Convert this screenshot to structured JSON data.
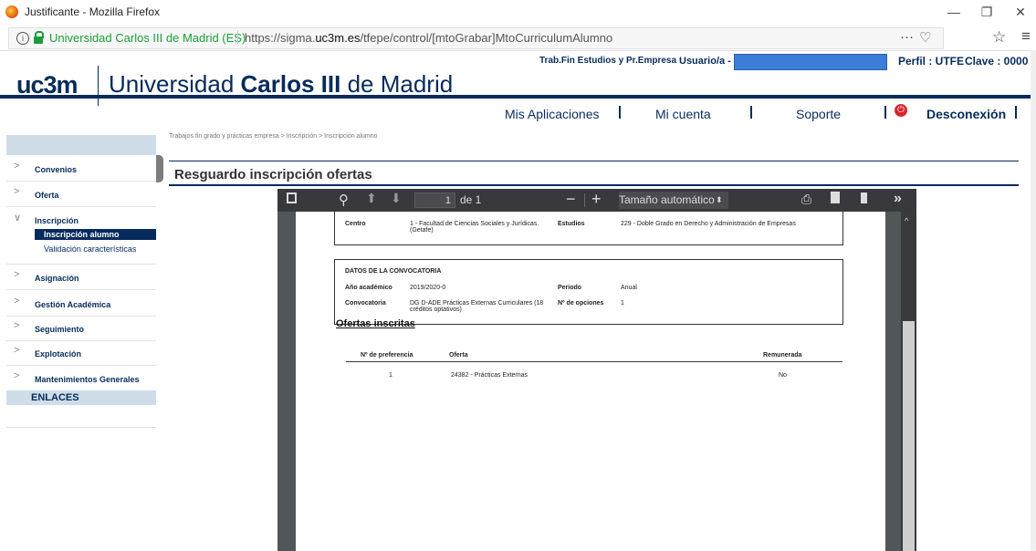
{
  "window": {
    "title": "Justificante - Mozilla Firefox",
    "min_glyph": "—",
    "max_glyph": "❐",
    "close_glyph": "✕"
  },
  "urlbar": {
    "org": "Universidad Carlos III de Madrid (ES)",
    "url_prefix": "https://sigma.",
    "url_domain": "uc3m.es",
    "url_path": "/tfepe/control/[mtoGrabar]MtoCurriculumAlumno",
    "more": "···",
    "pocket": "♡",
    "star": "☆",
    "menu": "≡"
  },
  "header": {
    "logo_short": "uc3m",
    "logo_pre": "Universidad ",
    "logo_bold": "Carlos III",
    "logo_post": " de Madrid",
    "program": "Trab.Fin Estudios y Pr.Empresa",
    "user_label": "Usuario/a -",
    "perfil": "Perfil : UTFE",
    "clave": "Clave : 0000"
  },
  "nav": {
    "apps": "Mis Aplicaciones",
    "account": "Mi cuenta",
    "support": "Soporte",
    "logout": "Desconexión"
  },
  "breadcrumb": "Trabajos fin grado y prácticas empresa > Inscripción > Inscripción alumno",
  "sidebar": {
    "items": [
      {
        "label": "Convenios"
      },
      {
        "label": "Oferta"
      },
      {
        "label": "Inscripción"
      },
      {
        "label": "Asignación"
      },
      {
        "label": "Gestión Académica"
      },
      {
        "label": "Seguimiento"
      },
      {
        "label": "Explotación"
      },
      {
        "label": "Mantenimientos Generales"
      }
    ],
    "sub_active": "Inscripción alumno",
    "sub_other": "Validación características",
    "links": "ENLACES"
  },
  "main": {
    "title": "Resguardo inscripción ofertas"
  },
  "pdf": {
    "page_num": "1",
    "page_total": "de 1",
    "zoom": "Tamaño automático",
    "centro_label": "Centro",
    "centro_value": "1 - Facultad de Ciencias Sociales y Jurídicas. (Getafe)",
    "estudios_label": "Estudios",
    "estudios_value": "229 - Doble Grado en Derecho y Administración de Empresas",
    "conv_heading": "DATOS DE LA CONVOCATORIA",
    "anio_label": "Año académico",
    "anio_value": "2019/2020-0",
    "periodo_label": "Periodo",
    "periodo_value": "Anual",
    "conv_label": "Convocatoria",
    "conv_value": "DG D-ADE Prácticas Externas Curriculares (18 créditos optativos)",
    "opciones_label": "Nº de opciones",
    "opciones_value": "1",
    "ofertas_heading": "Ofertas inscritas",
    "table_headers": [
      "Nº de preferencia",
      "Oferta",
      "Remunerada"
    ],
    "rows": [
      {
        "pref": "1",
        "oferta": "24382 - Prácticas Externas",
        "remunerada": "No"
      }
    ]
  }
}
